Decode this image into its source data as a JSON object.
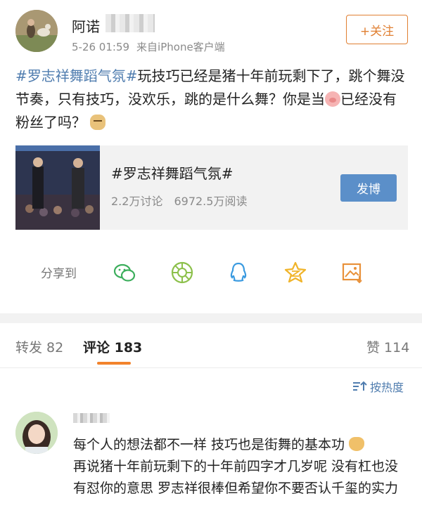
{
  "post": {
    "author_name": "阿诺",
    "time": "5-26 01:59",
    "source": "来自iPhone客户端",
    "follow_label": "+关注",
    "text": {
      "hashtag": "#罗志祥舞蹈气氛#",
      "part1": "玩技巧已经是猪十年前玩剩下了，跳个舞没节奏，只有技巧，没欢乐，跳的是什么舞？你是当",
      "part2": "已经没有粉丝了吗？"
    }
  },
  "topic_card": {
    "title": "#罗志祥舞蹈气氛#",
    "discussions": "2.2万讨论",
    "reads": "6972.5万阅读",
    "post_button": "发博"
  },
  "share": {
    "label": "分享到",
    "icons": [
      "wechat-icon",
      "moments-icon",
      "qq-icon",
      "qzone-icon",
      "save-image-icon"
    ]
  },
  "tabs": {
    "repost": "转发 82",
    "comments": "评论 183",
    "likes": "赞 114"
  },
  "sort": {
    "label": "按热度"
  },
  "comment": {
    "text_part1": "每个人的想法都不一样 技巧也是街舞的基本功",
    "text_part2": "再说猪十年前玩剩下的十年前四字才几岁呢 没有杠也没有怼你的意思 罗志祥很棒但希望你不要否认千玺的实力"
  },
  "colors": {
    "link": "#507daf",
    "accent": "#e07f32",
    "button": "#5b8fc9",
    "tab_indicator": "#f2832c"
  }
}
